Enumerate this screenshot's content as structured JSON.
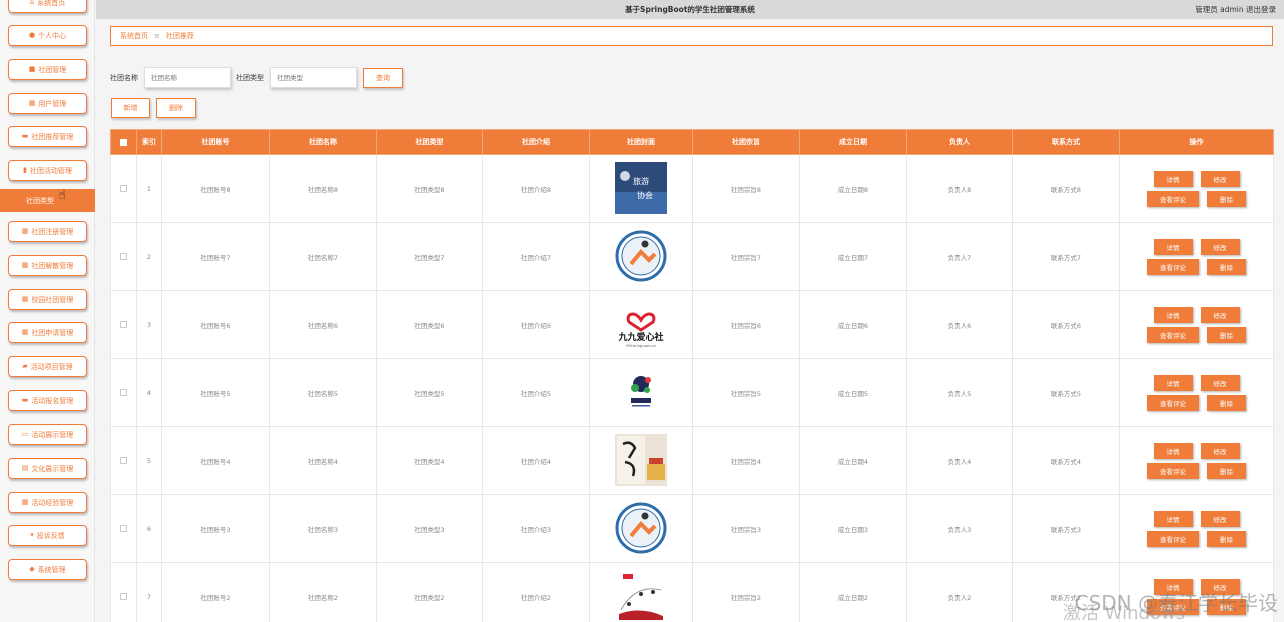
{
  "app": {
    "title": "基于SpringBoot的学生社团管理系统",
    "user": "管理员 admin",
    "logout": "退出登录"
  },
  "sidebar": {
    "items": [
      {
        "label": "系统首页",
        "icon": "home-icon",
        "glyph": "⌂"
      },
      {
        "label": "个人中心",
        "icon": "user-icon",
        "glyph": "●"
      },
      {
        "label": "社团管理",
        "icon": "briefcase-icon",
        "glyph": "■"
      },
      {
        "label": "用户管理",
        "icon": "grid-icon",
        "glyph": "▦"
      },
      {
        "label": "社团推荐管理",
        "icon": "chat-icon",
        "glyph": "▬"
      },
      {
        "label": "社团活动管理",
        "icon": "bar-chart-icon",
        "glyph": "▮"
      },
      {
        "label": "社团注册管理",
        "icon": "apps-icon",
        "glyph": "▦"
      },
      {
        "label": "社团解散管理",
        "icon": "apps-icon",
        "glyph": "▦"
      },
      {
        "label": "校园社团管理",
        "icon": "apps-icon",
        "glyph": "▦"
      },
      {
        "label": "社团申请管理",
        "icon": "apps-icon",
        "glyph": "▦"
      },
      {
        "label": "活动项目管理",
        "icon": "truck-icon",
        "glyph": "▰"
      },
      {
        "label": "活动报名管理",
        "icon": "chat-icon",
        "glyph": "▬"
      },
      {
        "label": "活动展示管理",
        "icon": "card-icon",
        "glyph": "▭"
      },
      {
        "label": "文化展示管理",
        "icon": "doc-icon",
        "glyph": "▤"
      },
      {
        "label": "活动经验管理",
        "icon": "apps-icon",
        "glyph": "▦"
      },
      {
        "label": "投诉反馈",
        "icon": "comment-icon",
        "glyph": "▾"
      },
      {
        "label": "系统管理",
        "icon": "pin-icon",
        "glyph": "◆"
      }
    ],
    "active": "社团类型"
  },
  "breadcrumb": {
    "home": "系统首页",
    "sep": "≡",
    "current": "社团推荐"
  },
  "search": {
    "name_label": "社团名称",
    "name_placeholder": "社团名称",
    "type_label": "社团类型",
    "type_placeholder": "社团类型",
    "query_button": "查询"
  },
  "actions": {
    "add": "新增",
    "delete": "删除"
  },
  "table": {
    "headers": [
      "索引",
      "社团账号",
      "社团名称",
      "社团类型",
      "社团介绍",
      "社团封面",
      "社团宗旨",
      "成立日期",
      "负责人",
      "联系方式",
      "操作"
    ],
    "rows": [
      {
        "idx": "1",
        "account": "社团账号8",
        "name": "社团名称8",
        "type": "社团类型8",
        "intro": "社团介绍8",
        "cover": "travel",
        "purpose": "社团宗旨8",
        "date": "成立日期8",
        "leader": "负责人8",
        "contact": "联系方式8"
      },
      {
        "idx": "2",
        "account": "社团账号7",
        "name": "社团名称7",
        "type": "社团类型7",
        "intro": "社团介绍7",
        "cover": "football",
        "purpose": "社团宗旨7",
        "date": "成立日期7",
        "leader": "负责人7",
        "contact": "联系方式7"
      },
      {
        "idx": "3",
        "account": "社团账号6",
        "name": "社团名称6",
        "type": "社团类型6",
        "intro": "社团介绍6",
        "cover": "heart",
        "purpose": "社团宗旨6",
        "date": "成立日期6",
        "leader": "负责人6",
        "contact": "联系方式6"
      },
      {
        "idx": "4",
        "account": "社团账号5",
        "name": "社团名称5",
        "type": "社团类型5",
        "intro": "社团介绍5",
        "cover": "splash",
        "purpose": "社团宗旨5",
        "date": "成立日期5",
        "leader": "负责人5",
        "contact": "联系方式5"
      },
      {
        "idx": "5",
        "account": "社团账号4",
        "name": "社团名称4",
        "type": "社团类型4",
        "intro": "社团介绍4",
        "cover": "calligraphy",
        "purpose": "社团宗旨4",
        "date": "成立日期4",
        "leader": "负责人4",
        "contact": "联系方式4"
      },
      {
        "idx": "6",
        "account": "社团账号3",
        "name": "社团名称3",
        "type": "社团类型3",
        "intro": "社团介绍3",
        "cover": "football",
        "purpose": "社团宗旨3",
        "date": "成立日期3",
        "leader": "负责人3",
        "contact": "联系方式3"
      },
      {
        "idx": "7",
        "account": "社团账号2",
        "name": "社团名称2",
        "type": "社团类型2",
        "intro": "社团介绍2",
        "cover": "music",
        "purpose": "社团宗旨2",
        "date": "成立日期2",
        "leader": "负责人2",
        "contact": "联系方式2"
      }
    ],
    "row_buttons": {
      "detail": "详情",
      "edit": "修改",
      "comments": "查看评论",
      "delete": "删除"
    }
  },
  "cover_text": {
    "travel": "旅游协会",
    "heart": "九九爱心社",
    "heart_sub": "99Caring.com.cn"
  },
  "overlay": {
    "watermark": "CSDN @春江学长毕设",
    "activation": "激活 Windows"
  },
  "colors": {
    "accent": "#f07c3a"
  }
}
